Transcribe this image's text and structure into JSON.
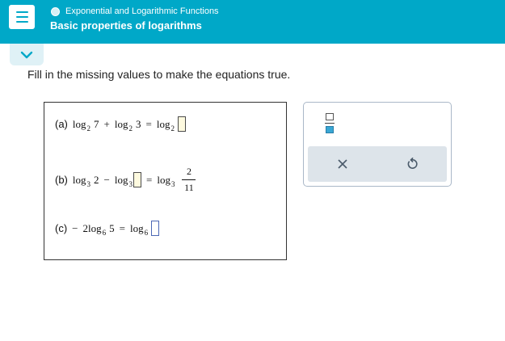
{
  "header": {
    "topic": "Exponential and Logarithmic Functions",
    "lesson": "Basic properties of logarithms"
  },
  "instructions": "Fill in the missing values to make the equations true.",
  "equations": {
    "a": {
      "label": "(a)",
      "log1": "log",
      "base1": "2",
      "arg1": "7",
      "plus": "+",
      "log2": "log",
      "base2": "2",
      "arg2": "3",
      "equals": "=",
      "log3": "log",
      "base3": "2"
    },
    "b": {
      "label": "(b)",
      "log1": "log",
      "base1": "3",
      "arg1": "2",
      "minus": "−",
      "log2": "log",
      "base2": "3",
      "equals": "=",
      "log3": "log",
      "base3": "3",
      "frac_num": "2",
      "frac_den": "11"
    },
    "c": {
      "label": "(c)",
      "neg": "−",
      "coef": "2",
      "log1": "log",
      "base1": "6",
      "arg1": "5",
      "equals": "=",
      "log2": "log",
      "base2": "6"
    }
  },
  "colors": {
    "header_bg": "#00a8c8",
    "answer_box_fill": "#fefadf",
    "active_box_border": "#4c68b5"
  },
  "icons": {
    "menu": "hamburger-icon",
    "collapse": "chevron-down-icon",
    "topic_status": "circle-icon",
    "fraction_tool": "fraction-icon",
    "clear": "close-icon",
    "undo": "undo-icon"
  }
}
